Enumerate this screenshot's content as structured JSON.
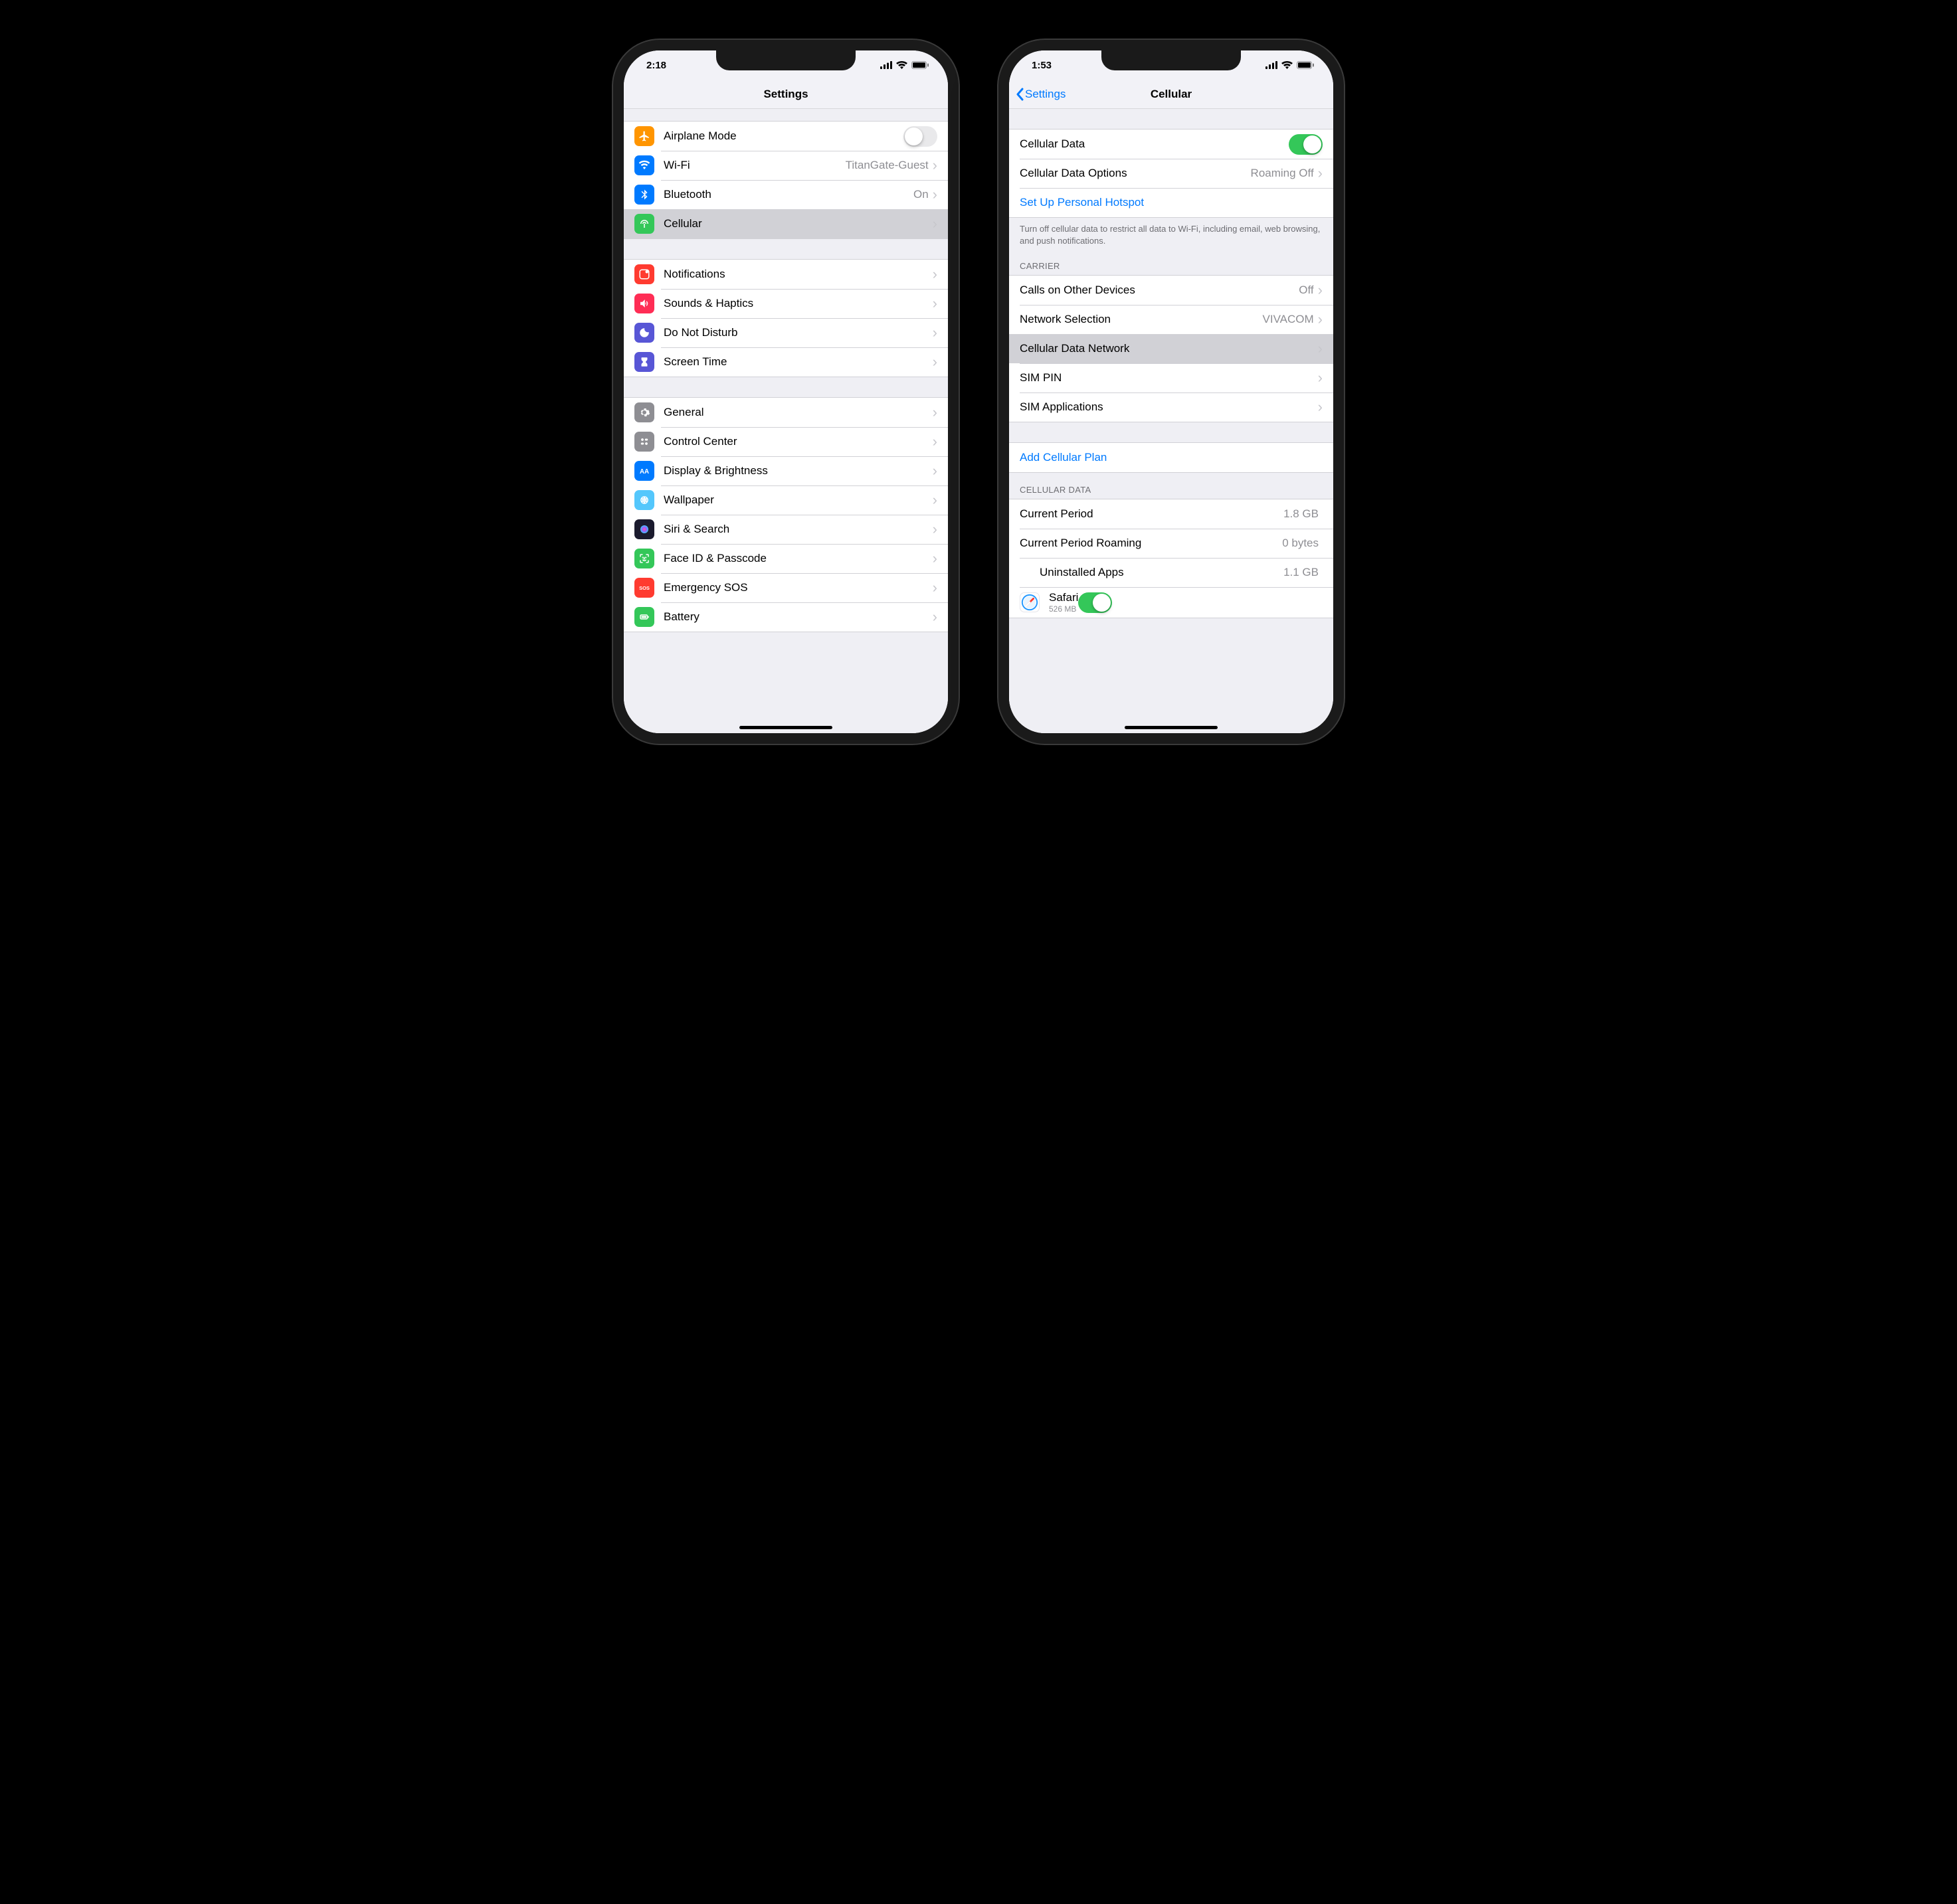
{
  "left": {
    "status": {
      "time": "2:18"
    },
    "nav": {
      "title": "Settings"
    },
    "sec1": [
      {
        "icon": "airplane",
        "color": "#ff9500",
        "label": "Airplane Mode",
        "toggle": false
      },
      {
        "icon": "wifi",
        "color": "#007aff",
        "label": "Wi-Fi",
        "detail": "TitanGate-Guest",
        "chev": true
      },
      {
        "icon": "bluetooth",
        "color": "#007aff",
        "label": "Bluetooth",
        "detail": "On",
        "chev": true
      },
      {
        "icon": "cellular",
        "color": "#34c759",
        "label": "Cellular",
        "chev": true,
        "selected": true
      }
    ],
    "sec2": [
      {
        "icon": "notifications",
        "color": "#ff3b30",
        "label": "Notifications",
        "chev": true
      },
      {
        "icon": "sounds",
        "color": "#ff2d55",
        "label": "Sounds & Haptics",
        "chev": true
      },
      {
        "icon": "dnd",
        "color": "#5856d6",
        "label": "Do Not Disturb",
        "chev": true
      },
      {
        "icon": "screentime",
        "color": "#5856d6",
        "label": "Screen Time",
        "chev": true
      }
    ],
    "sec3": [
      {
        "icon": "general",
        "color": "#8e8e93",
        "label": "General",
        "chev": true
      },
      {
        "icon": "control",
        "color": "#8e8e93",
        "label": "Control Center",
        "chev": true
      },
      {
        "icon": "display",
        "color": "#007aff",
        "label": "Display & Brightness",
        "chev": true
      },
      {
        "icon": "wallpaper",
        "color": "#54c7fc",
        "label": "Wallpaper",
        "chev": true
      },
      {
        "icon": "siri",
        "color": "#1b1b2e",
        "label": "Siri & Search",
        "chev": true
      },
      {
        "icon": "faceid",
        "color": "#34c759",
        "label": "Face ID & Passcode",
        "chev": true
      },
      {
        "icon": "sos",
        "color": "#ff3b30",
        "label": "Emergency SOS",
        "chev": true
      },
      {
        "icon": "battery",
        "color": "#34c759",
        "label": "Battery",
        "chev": true
      }
    ]
  },
  "right": {
    "status": {
      "time": "1:53"
    },
    "nav": {
      "back": "Settings",
      "title": "Cellular"
    },
    "sec1": {
      "rows": [
        {
          "label": "Cellular Data",
          "toggle": true
        },
        {
          "label": "Cellular Data Options",
          "detail": "Roaming Off",
          "chev": true
        },
        {
          "label": "Set Up Personal Hotspot",
          "link": true
        }
      ],
      "footer": "Turn off cellular data to restrict all data to Wi-Fi, including email, web browsing, and push notifications."
    },
    "sec2": {
      "header": "CARRIER",
      "rows": [
        {
          "label": "Calls on Other Devices",
          "detail": "Off",
          "chev": true
        },
        {
          "label": "Network Selection",
          "detail": "VIVACOM",
          "chev": true
        },
        {
          "label": "Cellular Data Network",
          "chev": true,
          "selected": true
        },
        {
          "label": "SIM PIN",
          "chev": true
        },
        {
          "label": "SIM Applications",
          "chev": true
        }
      ]
    },
    "sec3": {
      "rows": [
        {
          "label": "Add Cellular Plan",
          "link": true
        }
      ]
    },
    "sec4": {
      "header": "CELLULAR DATA",
      "rows": [
        {
          "label": "Current Period",
          "detail": "1.8 GB"
        },
        {
          "label": "Current Period Roaming",
          "detail": "0 bytes"
        },
        {
          "label": "Uninstalled Apps",
          "detail": "1.1 GB",
          "indent": true
        },
        {
          "app": "safari",
          "label": "Safari",
          "sub": "526 MB",
          "toggle": true
        }
      ]
    }
  }
}
